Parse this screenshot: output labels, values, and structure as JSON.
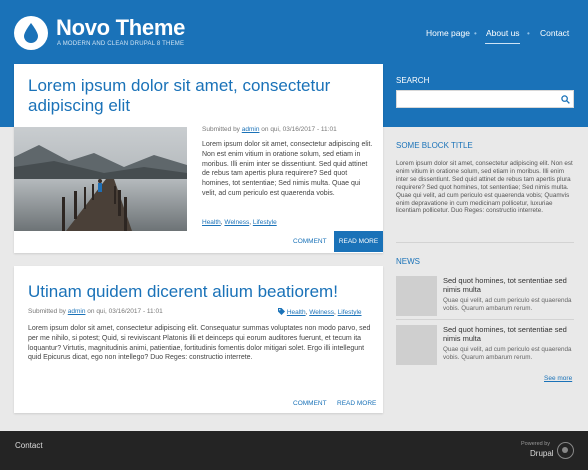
{
  "site": {
    "name": "Novo Theme",
    "slogan": "A MODERN AND CLEAN DRUPAL 8 THEME"
  },
  "nav": {
    "items": [
      {
        "label": "Home page"
      },
      {
        "label": "About us",
        "active": true
      },
      {
        "label": "Contact"
      }
    ],
    "separator": "•"
  },
  "articles": [
    {
      "title": "Lorem ipsum dolor sit amet, consectetur adipiscing elit",
      "submitted_prefix": "Submitted by",
      "author": "admin",
      "date": "on qui, 03/16/2017 - 11:01",
      "body": "Lorem ipsum dolor sit amet, consectetur adipiscing elit. Non est enim vitium in oratione solum, sed etiam in moribus. Illi enim inter se dissentiunt. Sed quid attinet de rebus tam apertis plura requirere? Sed quot homines, tot sententiae; Sed nimis multa. Quae qui velit, ad cum periculo est quaerenda vobis.",
      "tags": [
        "Health",
        "Welness",
        "Lifestyle"
      ],
      "comment_label": "COMMENT",
      "read_more_label": "READ MORE"
    },
    {
      "title": "Utinam quidem dicerent alium beatiorem!",
      "submitted_prefix": "Submitted by",
      "author": "admin",
      "date": "on qui, 03/16/2017 - 11:01",
      "body": "Lorem ipsum dolor sit amet, consectetur adipiscing elit. Consequatur summas voluptates non modo parvo, sed per me nihilo, si potest; Quid, si reviviscant Platonis illi et deinceps qui eorum auditores fuerunt, et tecum ita loquantur? Virtutis, magnitudinis animi, patientiae, fortitudinis fomentis dolor mitigari solet. Ergo illi intellegunt quid Epicurus dicat, ego non intellego? Duo Reges: constructio interrete.",
      "tags": [
        "Health",
        "Welness",
        "Lifestyle"
      ],
      "comment_label": "COMMENT",
      "read_more_label": "READ MORE"
    }
  ],
  "sidebar": {
    "search": {
      "title": "SEARCH",
      "placeholder": ""
    },
    "block": {
      "title": "SOME BLOCK TITLE",
      "text": "Lorem ipsum dolor sit amet, consectetur adipiscing elit. Non est enim vitium in oratione solum, sed etiam in moribus. Illi enim inter se dissentiunt. Sed quid attinet de rebus tam apertis plura requirere? Sed quot homines, tot sententiae; Sed nimis multa. Quae qui velit, ad cum periculo est quaerenda vobis; Quamvis enim depravatione in cum medicinam pollicetur, luxuriae licentiam pollicetur. Duo Reges: constructio interrete."
    },
    "news": {
      "title": "NEWS",
      "items": [
        {
          "title": "Sed quot homines, tot sententiae sed nimis multa",
          "body": "Quae qui velit, ad cum periculo est quaerenda vobis. Quarum ambarum rerum."
        },
        {
          "title": "Sed quot homines, tot sententiae sed nimis multa",
          "body": "Quae qui velit, ad cum periculo est quaerenda vobis. Quarum ambarum rerum."
        }
      ],
      "see_more": "See more"
    }
  },
  "footer": {
    "link": "Contact",
    "powered_by": "Powered by",
    "platform": "Drupal"
  },
  "colors": {
    "primary": "#1a72b8",
    "footer": "#242424",
    "background": "#e9e9e9"
  },
  "icons": {
    "logo": "water-drop-icon",
    "search": "search-icon",
    "tag": "tag-icon",
    "drupal": "drupal-icon"
  }
}
